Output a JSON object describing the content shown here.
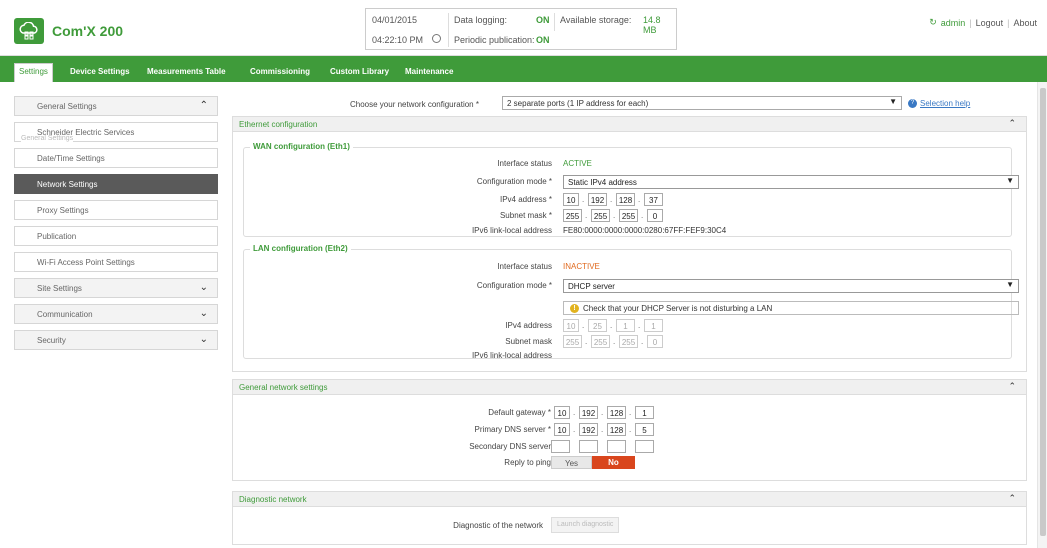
{
  "header": {
    "app_title": "Com'X 200",
    "date": "04/01/2015",
    "time": "04:22:10 PM",
    "data_logging_label": "Data logging:",
    "data_logging_value": "ON",
    "periodic_publication_label": "Periodic publication:",
    "periodic_publication_value": "ON",
    "storage_label": "Available storage:",
    "storage_value": "14.8 MB",
    "user": "admin",
    "logout": "Logout",
    "about": "About"
  },
  "nav": {
    "tabs": [
      "Settings",
      "Device Settings",
      "Measurements Table",
      "Commissioning",
      "Custom Library",
      "Maintenance"
    ]
  },
  "sidebar": {
    "general_settings": "General Settings",
    "ghost_label": "General Settings",
    "items": [
      "Schneider Electric Services",
      "Date/Time Settings",
      "Network Settings",
      "Proxy Settings",
      "Publication",
      "Wi-Fi Access Point Settings"
    ],
    "groups": [
      "Site Settings",
      "Communication",
      "Security"
    ]
  },
  "main": {
    "network_choice_label": "Choose your network configuration *",
    "network_choice_value": "2 separate ports (1 IP address for each)",
    "selection_help": "Selection help",
    "ethernet": {
      "title": "Ethernet configuration",
      "wan": {
        "legend": "WAN configuration (Eth1)",
        "interface_status_label": "Interface status",
        "interface_status": "ACTIVE",
        "config_mode_label": "Configuration mode *",
        "config_mode": "Static IPv4 address",
        "ipv4_label": "IPv4 address *",
        "ipv4": [
          "10",
          "192",
          "128",
          "37"
        ],
        "subnet_label": "Subnet mask *",
        "subnet": [
          "255",
          "255",
          "255",
          "0"
        ],
        "ipv6_label": "IPv6 link-local address",
        "ipv6": "FE80:0000:0000:0000:0280:67FF:FEF9:30C4"
      },
      "lan": {
        "legend": "LAN configuration (Eth2)",
        "interface_status_label": "Interface status",
        "interface_status": "INACTIVE",
        "config_mode_label": "Configuration mode *",
        "config_mode": "DHCP server",
        "warning": "Check that your DHCP Server is not disturbing a LAN",
        "ipv4_label": "IPv4 address",
        "ipv4": [
          "10",
          "25",
          "1",
          "1"
        ],
        "subnet_label": "Subnet mask",
        "subnet": [
          "255",
          "255",
          "255",
          "0"
        ],
        "ipv6_label": "IPv6 link-local address"
      }
    },
    "general_network": {
      "title": "General network settings",
      "gateway_label": "Default gateway *",
      "gateway": [
        "10",
        "192",
        "128",
        "1"
      ],
      "dns1_label": "Primary DNS server *",
      "dns1": [
        "10",
        "192",
        "128",
        "5"
      ],
      "dns2_label": "Secondary DNS server",
      "dns2": [
        "",
        "",
        "",
        ""
      ],
      "ping_label": "Reply to ping",
      "ping_yes": "Yes",
      "ping_no": "No"
    },
    "diagnostic": {
      "title": "Diagnostic network",
      "label": "Diagnostic of the network",
      "button": "Launch diagnostic"
    }
  }
}
